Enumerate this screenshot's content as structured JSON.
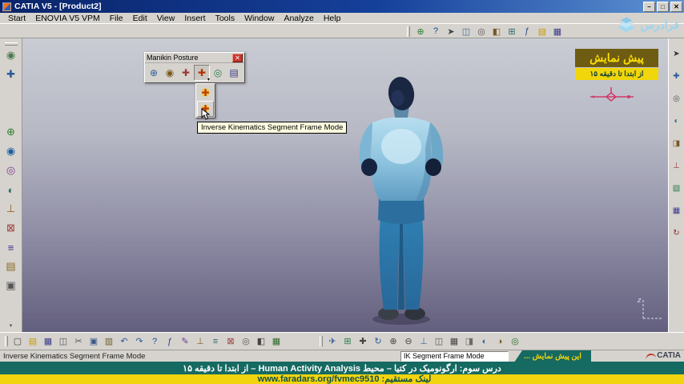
{
  "window": {
    "title": "CATIA V5 - [Product2]",
    "controls": {
      "minimize": "–",
      "maximize": "□",
      "close": "✕"
    }
  },
  "menu": {
    "items": [
      "Start",
      "ENOVIA V5 VPM",
      "File",
      "Edit",
      "View",
      "Insert",
      "Tools",
      "Window",
      "Analyze",
      "Help"
    ]
  },
  "brand": {
    "faradars_logo": "فرادرس",
    "catia_logo": "CATIA"
  },
  "top_toolbar": {
    "icons": [
      {
        "name": "manikin-tool-icon",
        "glyph": "⊕",
        "color": "#2e7d32"
      },
      {
        "name": "help-icon",
        "glyph": "?",
        "color": "#1a4a9a"
      },
      {
        "name": "whats-this-icon",
        "glyph": "➤",
        "color": "#444444"
      },
      {
        "name": "window-layout-icon",
        "glyph": "◫",
        "color": "#3a6a9a"
      },
      {
        "name": "camera-view-icon",
        "glyph": "◎",
        "color": "#555555"
      },
      {
        "name": "render-style-icon",
        "glyph": "◧",
        "color": "#7a5a2a"
      },
      {
        "name": "catalog-icon",
        "glyph": "⊞",
        "color": "#2a6a6a"
      },
      {
        "name": "knowledge-fx-icon",
        "glyph": "ƒ",
        "color": "#2a4a8a"
      },
      {
        "name": "open-folder-icon",
        "glyph": "▤",
        "color": "#c89a00"
      },
      {
        "name": "save-disk-icon",
        "glyph": "▦",
        "color": "#39398a"
      }
    ]
  },
  "left_toolbar": {
    "top_icons": [
      {
        "name": "workbench-icon",
        "glyph": "◉",
        "color": "#4a7a4a"
      },
      {
        "name": "compass-tool-icon",
        "glyph": "✚",
        "color": "#2a5a9a"
      }
    ],
    "icons": [
      {
        "name": "new-manikin-icon",
        "glyph": "⊕",
        "color": "#2e7d32"
      },
      {
        "name": "posture-tool-icon",
        "glyph": "◉",
        "color": "#1f5fa0"
      },
      {
        "name": "reach-envelope-icon",
        "glyph": "◎",
        "color": "#7a3a8a"
      },
      {
        "name": "vision-window-icon",
        "glyph": "◐",
        "color": "#2a6a6a"
      },
      {
        "name": "measure-tool-icon",
        "glyph": "⊥",
        "color": "#8a5a1a"
      },
      {
        "name": "constraint-icon",
        "glyph": "⊠",
        "color": "#9a3a3a"
      },
      {
        "name": "analysis-icon",
        "glyph": "≡",
        "color": "#3a3a8a"
      },
      {
        "name": "catalog-browser-icon",
        "glyph": "▤",
        "color": "#8a6a2a"
      },
      {
        "name": "settings-icon",
        "glyph": "▣",
        "color": "#555555"
      }
    ]
  },
  "right_toolbar": {
    "icons": [
      {
        "name": "select-arrow-icon",
        "glyph": "➤",
        "color": "#333333"
      },
      {
        "name": "smart-pick-icon",
        "glyph": "✚",
        "color": "#2a5a9a"
      },
      {
        "name": "viewpoint-icon",
        "glyph": "◎",
        "color": "#555555"
      },
      {
        "name": "hide-show-icon",
        "glyph": "◐",
        "color": "#3a6a9a"
      },
      {
        "name": "swap-space-icon",
        "glyph": "◨",
        "color": "#7a5a2a"
      },
      {
        "name": "axis-system-icon",
        "glyph": "⊥",
        "color": "#9a3a3a"
      },
      {
        "name": "plane-icon",
        "glyph": "▧",
        "color": "#2a7a4a"
      },
      {
        "name": "palette-icon",
        "glyph": "▦",
        "color": "#3a3a8a"
      },
      {
        "name": "update-icon",
        "glyph": "↻",
        "color": "#8a2a2a"
      }
    ]
  },
  "manikin_toolbar": {
    "title": "Manikin Posture",
    "close_glyph": "✕",
    "icons": [
      {
        "name": "posture-editor-icon",
        "glyph": "⊕",
        "color": "#2a5a9a"
      },
      {
        "name": "standard-pose-icon",
        "glyph": "◉",
        "color": "#7a5a1a"
      },
      {
        "name": "forward-kinematics-icon",
        "glyph": "✚",
        "color": "#9a3a3a"
      },
      {
        "name": "inverse-kinematics-icon",
        "glyph": "✚",
        "color": "#b83000",
        "active": true
      },
      {
        "name": "reach-mode-icon",
        "glyph": "◎",
        "color": "#2a7a4a"
      },
      {
        "name": "pose-catalog-icon",
        "glyph": "▤",
        "color": "#3a3a8a"
      }
    ],
    "dropdown": [
      {
        "name": "ik-worksegment-frame-mode-icon",
        "glyph": "✚"
      },
      {
        "name": "ik-segment-frame-mode-icon",
        "glyph": "✚"
      }
    ],
    "tooltip": "Inverse Kinematics Segment Frame Mode"
  },
  "viewport": {
    "preview_badge": {
      "title": "پیش نمایش",
      "subtitle": "از ابتدا تا دقیقه ۱۵"
    },
    "axis_label": "z"
  },
  "bottom_toolbar": {
    "left_icons": [
      {
        "name": "new-file-icon",
        "glyph": "▢",
        "color": "#444444"
      },
      {
        "name": "open-folder-icon",
        "glyph": "▤",
        "color": "#c89a00"
      },
      {
        "name": "save-disk-icon",
        "glyph": "▦",
        "color": "#39398a"
      },
      {
        "name": "print-icon",
        "glyph": "◫",
        "color": "#555555"
      },
      {
        "name": "cut-icon",
        "glyph": "✂",
        "color": "#555555"
      },
      {
        "name": "copy-icon",
        "glyph": "▣",
        "color": "#3a5a8a"
      },
      {
        "name": "paste-icon",
        "glyph": "▥",
        "color": "#6a5a2a"
      },
      {
        "name": "undo-icon",
        "glyph": "↶",
        "color": "#2a5a9a"
      },
      {
        "name": "redo-icon",
        "glyph": "↷",
        "color": "#2a5a9a"
      },
      {
        "name": "help-icon",
        "glyph": "?",
        "color": "#1a4a9a"
      },
      {
        "name": "knowledge-fx-icon",
        "glyph": "ƒ",
        "color": "#2a4a8a"
      },
      {
        "name": "annotation-icon",
        "glyph": "✎",
        "color": "#6a3a8a"
      },
      {
        "name": "measure-icon",
        "glyph": "⊥",
        "color": "#8a5a1a"
      },
      {
        "name": "graph-tree-icon",
        "glyph": "≡",
        "color": "#2a6a6a"
      },
      {
        "name": "lock-icon",
        "glyph": "⊠",
        "color": "#9a3a3a"
      },
      {
        "name": "camera-icon",
        "glyph": "◎",
        "color": "#555555"
      },
      {
        "name": "film-icon",
        "glyph": "◧",
        "color": "#444444"
      },
      {
        "name": "table-icon",
        "glyph": "▦",
        "color": "#2a6a2a"
      }
    ],
    "right_icons": [
      {
        "name": "fly-mode-icon",
        "glyph": "✈",
        "color": "#2a5a9a"
      },
      {
        "name": "fit-all-in-icon",
        "glyph": "⊞",
        "color": "#2a7a4a"
      },
      {
        "name": "pan-icon",
        "glyph": "✚",
        "color": "#444444"
      },
      {
        "name": "rotate-icon",
        "glyph": "↻",
        "color": "#2a5a9a"
      },
      {
        "name": "zoom-in-icon",
        "glyph": "⊕",
        "color": "#444444"
      },
      {
        "name": "zoom-out-icon",
        "glyph": "⊖",
        "color": "#444444"
      },
      {
        "name": "normal-view-icon",
        "glyph": "⊥",
        "color": "#3a6a9a"
      },
      {
        "name": "multi-view-icon",
        "glyph": "◫",
        "color": "#555555"
      },
      {
        "name": "wireframe-icon",
        "glyph": "▦",
        "color": "#444444"
      },
      {
        "name": "shading-icon",
        "glyph": "◨",
        "color": "#6a6a6a"
      },
      {
        "name": "hide-show-icon",
        "glyph": "◐",
        "color": "#3a6a9a"
      },
      {
        "name": "swap-visible-icon",
        "glyph": "◑",
        "color": "#7a5a2a"
      },
      {
        "name": "screen-capture-icon",
        "glyph": "◎",
        "color": "#2a6a2a"
      }
    ]
  },
  "status_bar": {
    "message": "Inverse Kinematics Segment Frame Mode",
    "field_value": "IK Segment Frame Mode"
  },
  "banner": {
    "mini_note": "این پیش نمایش ...",
    "lesson": "درس سوم: ارگونومیک در کتیا – محیط Human Activity Analysis – از ابتدا تا دقیقه ۱۵",
    "link_label": "لینک مستقیم:",
    "link_url": "www.faradars.org/fvmec9510"
  },
  "colors": {
    "banner_teal": "#156a62",
    "banner_yellow": "#f2d40e",
    "badge_olive": "#6e5c12",
    "badge_text_yellow": "#ffdf00",
    "titlebar_blue": "#0a246a",
    "close_red": "#c8372c"
  }
}
